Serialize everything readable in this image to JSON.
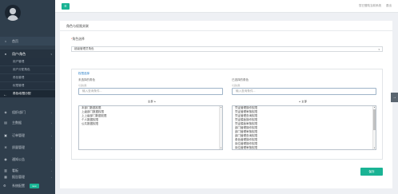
{
  "sidebar": {
    "user_caption": "",
    "home": "首页",
    "user_manage": "用户/角色",
    "user_sub": [
      "用户管理",
      "用户分配角色",
      "角色管理",
      "权限管理",
      "角色/权限分配"
    ],
    "nav_items": [
      "组织/部门",
      "主数据",
      "订单管理",
      "质量管理",
      "通知公告",
      "看板",
      "报告管理"
    ],
    "bottom_label": "系统配置",
    "bottom_badge": "new"
  },
  "topbar": {
    "menu_icon": "menu-icon",
    "right_items": [
      "您已登陆当前系统",
      "退出"
    ]
  },
  "panel": {
    "title": "角色与权限关联",
    "role_label": "角色选择",
    "role_value": "超级管理员角色",
    "perm_label": "权限选择",
    "left_title": "未选择的角色",
    "left_sub": "可选权限",
    "left_placeholder": "输入查询条件...",
    "right_title": "已选择的角色",
    "right_sub": "可选权限",
    "right_placeholder": "输入查询条件...",
    "left_move": "全部 ▸",
    "right_move": "◂ 全部",
    "left_items": [
      "本部门数据权限",
      "上级部门数据权限",
      "上上级部门数据权限",
      "个人数据权限",
      "公共数据权限"
    ],
    "right_items": [
      "凭证管理操作权限",
      "凭证管理审核权限",
      "凭证管理查询权限",
      "凭证模板操作权限",
      "凭证模板审核权限",
      "部门管理操作权限",
      "部门管理审核权限",
      "部门管理查询权限",
      "角色管理操作权限",
      "岗位管理操作权限",
      "岗位管理审核权限"
    ],
    "save_label": "保存"
  },
  "colors": {
    "accent": "#1ab394",
    "sidebar_bg": "#2f3e4c",
    "link": "#2a7fc8"
  }
}
